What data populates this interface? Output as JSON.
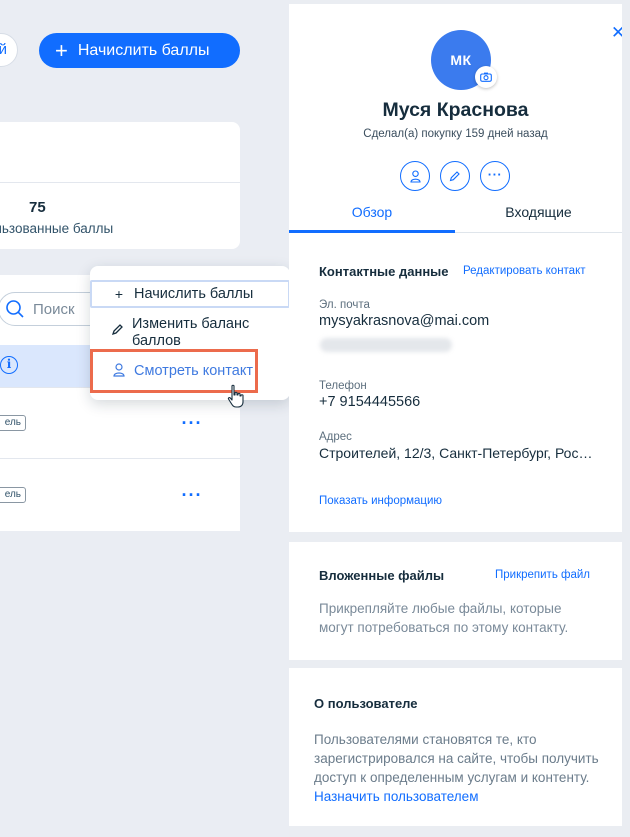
{
  "left": {
    "partial_button_label": "й",
    "add_points_button": "Начислить баллы",
    "stats": {
      "value": "75",
      "label": "льзованные баллы"
    },
    "search_placeholder": "Поиск",
    "row_tag": "ель"
  },
  "menu": {
    "items": [
      {
        "icon": "plus-icon",
        "label": "Начислить баллы"
      },
      {
        "icon": "pencil-icon",
        "label": "Изменить баланс баллов"
      },
      {
        "icon": "person-icon",
        "label": "Смотреть контакт"
      }
    ]
  },
  "panel": {
    "avatar_initials": "МК",
    "name": "Муся Краснова",
    "purchase_note": "Сделал(а) покупку 159 дней назад",
    "tabs": [
      "Обзор",
      "Входящие"
    ],
    "contact": {
      "title": "Контактные данные",
      "edit_link": "Редактировать контакт",
      "email_label": "Эл. почта",
      "email": "mysyakrasnova@mai.com",
      "phone_label": "Телефон",
      "phone": "+7 9154445566",
      "address_label": "Адрес",
      "address": "Строителей, 12/3, Санкт-Петербург, Рос…",
      "show_info": "Показать информацию"
    },
    "files": {
      "title": "Вложенные файлы",
      "attach_link": "Прикрепить файл",
      "text": "Прикрепляйте любые файлы, которые могут потребоваться по этому контакту."
    },
    "about": {
      "title": "О пользователе",
      "text": "Пользователями становятся те, кто зарегистрировался на сайте, чтобы получить доступ к определенным услугам и контенту.",
      "assign_link": "Назначить пользователем"
    }
  },
  "colors": {
    "accent": "#116dff",
    "highlight": "#ec6b4c",
    "avatar": "#3b7bee"
  }
}
